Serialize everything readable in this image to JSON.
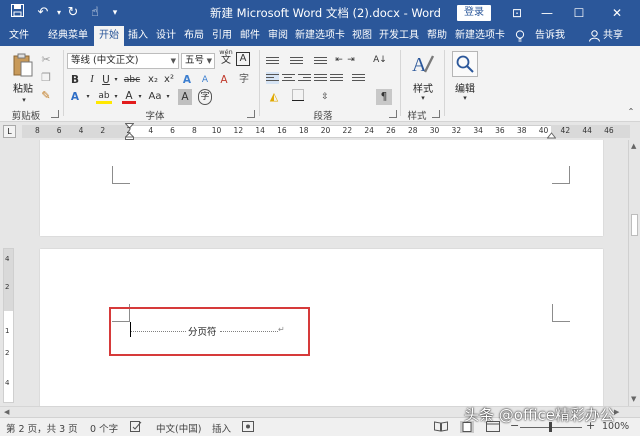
{
  "title_bar": {
    "document_title": "新建 Microsoft Word 文档 (2).docx - Word",
    "login_label": "登录",
    "save_icon": "save-icon",
    "undo_icon": "undo-icon",
    "redo_icon": "redo-icon",
    "touch_mode_icon": "touch-mode-icon",
    "window_glyphs": {
      "ribbon_options": "⊡",
      "minimize": "—",
      "restore": "☐",
      "close": "✕"
    }
  },
  "tabs": [
    {
      "label": "文件",
      "active": false
    },
    {
      "label": "经典菜单",
      "active": false
    },
    {
      "label": "开始",
      "active": true
    },
    {
      "label": "插入",
      "active": false
    },
    {
      "label": "设计",
      "active": false
    },
    {
      "label": "布局",
      "active": false
    },
    {
      "label": "引用",
      "active": false
    },
    {
      "label": "邮件",
      "active": false
    },
    {
      "label": "审阅",
      "active": false
    },
    {
      "label": "新建选项卡",
      "active": false
    },
    {
      "label": "视图",
      "active": false
    },
    {
      "label": "开发工具",
      "active": false
    },
    {
      "label": "帮助",
      "active": false
    },
    {
      "label": "新建选项卡",
      "active": false
    }
  ],
  "tell_me": "告诉我",
  "share": "共享",
  "ribbon": {
    "clipboard": {
      "paste_label": "粘贴",
      "group_label": "剪贴板"
    },
    "font": {
      "font_name": "等线 (中文正文)",
      "font_size": "五号",
      "wen_label": "wén",
      "wen_char": "文",
      "boxed_a": "A",
      "bold": "B",
      "italic": "I",
      "underline": "U",
      "strike": "abc",
      "subscript": "x₂",
      "superscript": "x²",
      "text_effect": "A",
      "highlight": "ab",
      "font_color": "A",
      "change_case": "Aa",
      "grow": "A",
      "shrink": "A",
      "clear_format": "A",
      "char_shading": "A",
      "enclose": "字",
      "group_label": "字体"
    },
    "paragraph": {
      "group_label": "段落",
      "sort": "A↓",
      "show_marks": "¶"
    },
    "styles": {
      "styles_label": "样式",
      "group_label": "样式"
    },
    "editing": {
      "label": "编辑"
    }
  },
  "ruler": {
    "corner": "L",
    "numbers": [
      "8",
      "6",
      "4",
      "2",
      "2",
      "4",
      "6",
      "8",
      "10",
      "12",
      "14",
      "16",
      "18",
      "20",
      "22",
      "24",
      "26",
      "28",
      "30",
      "32",
      "34",
      "36",
      "38",
      "40",
      "42",
      "44",
      "46"
    ]
  },
  "vertical_ruler": {
    "numbers": [
      "4",
      "2",
      "1",
      "2",
      "4"
    ]
  },
  "document": {
    "page_break_text": "分页符",
    "paragraph_mark": "↵"
  },
  "status_bar": {
    "page": "第 2 页，共 3 页",
    "words": "0 个字",
    "language": "中文(中国)",
    "mode": "插入",
    "zoom": "100%"
  },
  "watermark": "头条 @office精彩办公",
  "colors": {
    "brand": "#2b579a",
    "highlight_box": "#d63a3a",
    "font_color_red": "#e21b1b",
    "highlight_yellow": "#ffe800"
  }
}
